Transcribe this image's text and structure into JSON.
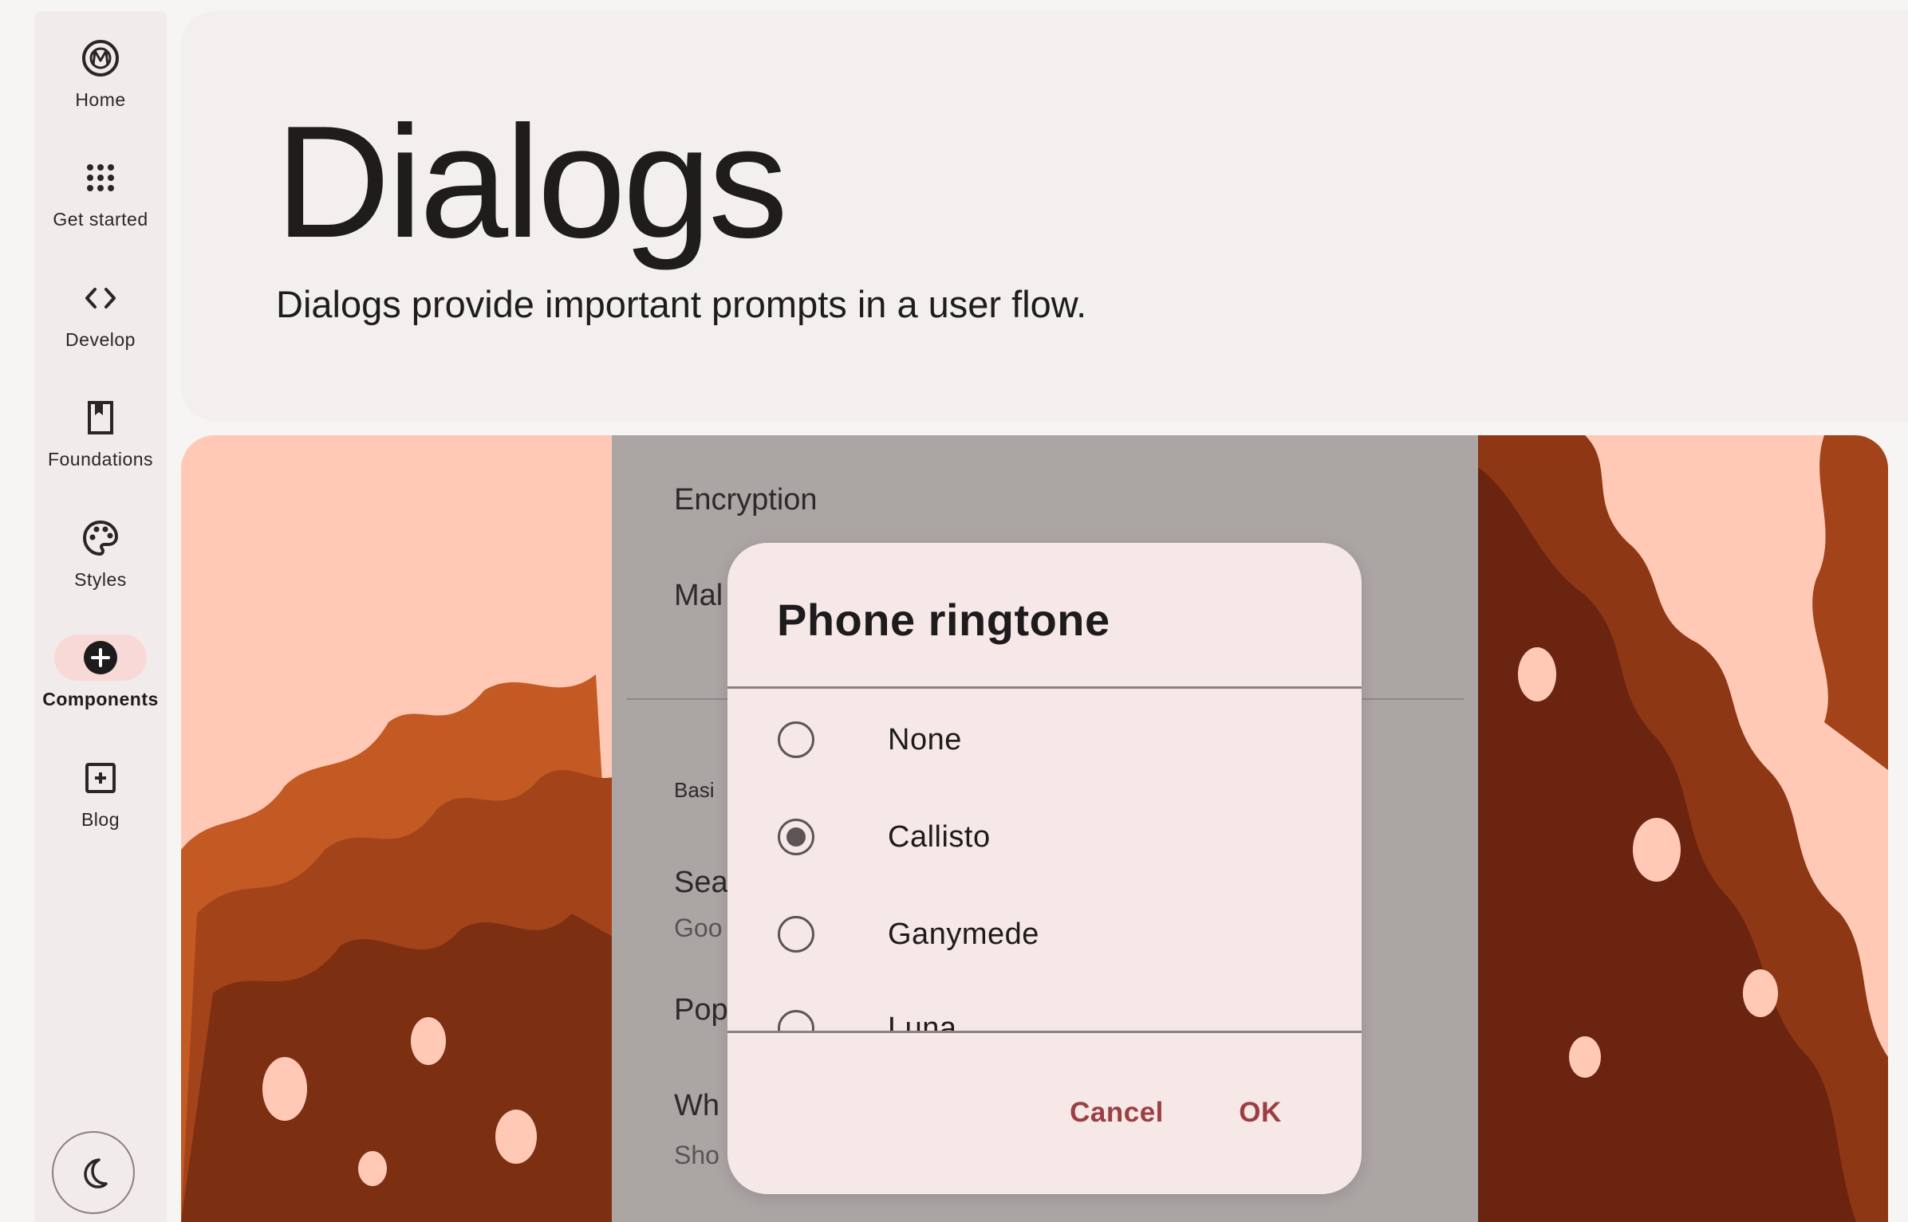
{
  "sidebar": {
    "items": [
      {
        "label": "Home",
        "icon": "material-logo-icon"
      },
      {
        "label": "Get started",
        "icon": "apps-grid-icon"
      },
      {
        "label": "Develop",
        "icon": "code-brackets-icon"
      },
      {
        "label": "Foundations",
        "icon": "bookmark-icon"
      },
      {
        "label": "Styles",
        "icon": "palette-icon"
      },
      {
        "label": "Components",
        "icon": "add-circle-icon",
        "active": true
      },
      {
        "label": "Blog",
        "icon": "add-box-icon"
      }
    ],
    "theme_toggle_icon": "dark-mode-moon-icon"
  },
  "header": {
    "title": "Dialogs",
    "subtitle": "Dialogs provide important prompts in a user flow."
  },
  "phone_screen": {
    "rows": [
      "Encryption",
      "Mal",
      "Basi",
      "Sea",
      "Goo",
      "Pop",
      "Wh",
      "Sho"
    ]
  },
  "dialog": {
    "title": "Phone ringtone",
    "options": [
      {
        "label": "None",
        "selected": false
      },
      {
        "label": "Callisto",
        "selected": true
      },
      {
        "label": "Ganymede",
        "selected": false
      },
      {
        "label": "Luna",
        "selected": false
      }
    ],
    "cancel_label": "Cancel",
    "ok_label": "OK"
  },
  "colors": {
    "accent": "#9c3f43",
    "hero_background": "#ffc9b6",
    "active_indicator": "#f9d9d7",
    "dialog_surface": "#f6e8e7",
    "scrim": "#aba5a4"
  }
}
